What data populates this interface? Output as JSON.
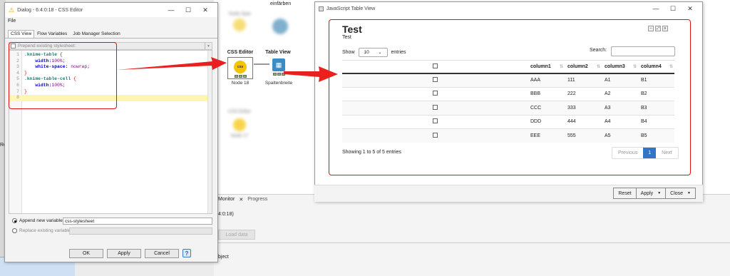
{
  "dialog": {
    "title": "Dialog - 6:4:0:18 - CSS Editor",
    "menu_file": "File",
    "tabs": [
      "CSS View",
      "Flow Variables",
      "Job Manager Selection"
    ],
    "prepend_label": "Prepend existing stylesheet:",
    "code_lines": [
      {
        "n": "1",
        "sel": ".knime-table",
        "brace": " {"
      },
      {
        "n": "2",
        "prop": "width:",
        "val": "100%;"
      },
      {
        "n": "3",
        "prop": "white-space:",
        "val": " nowrap;"
      },
      {
        "n": "4",
        "brace": "}"
      },
      {
        "n": "5",
        "sel": ".knime-table-cell",
        "brace": " {"
      },
      {
        "n": "6",
        "prop": "width:",
        "val": "100%;"
      },
      {
        "n": "7",
        "brace": "}"
      },
      {
        "n": "8"
      }
    ],
    "append_label": "Append new variable:",
    "append_value": "css-stylesheet",
    "replace_label": "Replace existing variable:",
    "ok": "OK",
    "apply": "Apply",
    "cancel": "Cancel",
    "help": "?"
  },
  "workflow": {
    "css_node_label": "CSS Editor",
    "css_node_icon": "css",
    "css_node_sub": "Node 18",
    "table_node_label": "Table View",
    "table_node_sub": "Spaltenbreite",
    "top_label": "einfärben",
    "blurred_label_1": "Node Spal",
    "blurred_label_2": "CSS Editor",
    "blurred_label_3": "Node 17",
    "monitor_tab": "Monitor",
    "progress_tab": "Progress",
    "node_ref": "4:0:18)",
    "load_data": "Load data",
    "object_text": "bject",
    "left_edge_text": "Re"
  },
  "table_window": {
    "title": "JavaScript Table View",
    "table_title": "Test",
    "table_subtitle": "Test",
    "show_label": "Show",
    "entries_value": "10",
    "entries_label": "entries",
    "search_label": "Search:",
    "columns": [
      "column1",
      "column2",
      "column3",
      "column4"
    ],
    "rows": [
      [
        "AAA",
        "111",
        "A1",
        "B1"
      ],
      [
        "BBB",
        "222",
        "A2",
        "B2"
      ],
      [
        "CCC",
        "333",
        "A3",
        "B3"
      ],
      [
        "DDD",
        "444",
        "A4",
        "B4"
      ],
      [
        "EEE",
        "555",
        "A5",
        "B5"
      ]
    ],
    "info": "Showing 1 to 5 of 5 entries",
    "pager_prev": "Previous",
    "pager_page": "1",
    "pager_next": "Next",
    "reset": "Reset",
    "apply": "Apply",
    "close": "Close"
  },
  "colors": {
    "annotation_red": "#e01010",
    "accent_blue": "#3274c6",
    "css_node_yellow": "#f5c400",
    "table_node_blue": "#3a8dc4"
  }
}
